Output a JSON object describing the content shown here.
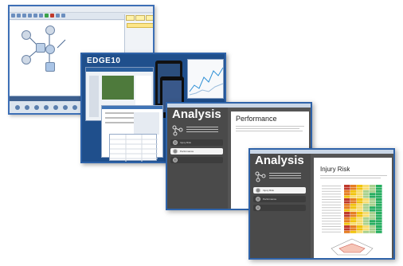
{
  "workflow_window": {
    "nodes": [
      {
        "id": "n1"
      },
      {
        "id": "n2"
      },
      {
        "id": "n3"
      },
      {
        "id": "n4"
      },
      {
        "id": "n5"
      },
      {
        "id": "n6"
      }
    ]
  },
  "edge10_window": {
    "logo": "EDGE10"
  },
  "analysis_performance": {
    "heading": "Analysis",
    "pane_title": "Performance",
    "menu": [
      {
        "label": "Injury Risk",
        "active": false
      },
      {
        "label": "Performance",
        "active": true
      },
      {
        "label": "",
        "active": false
      }
    ]
  },
  "analysis_injury": {
    "heading": "Analysis",
    "pane_title": "Injury Risk",
    "menu": [
      {
        "label": "Injury Risk",
        "active": true
      },
      {
        "label": "Performance",
        "active": false
      },
      {
        "label": "",
        "active": false
      }
    ]
  },
  "colors": {
    "window_border": "#2f63a9",
    "analysis_bg": "#555555",
    "edge10_bg": "#1f4f8c",
    "heatmap_high": "#c0392b",
    "heatmap_mid": "#f1c40f",
    "heatmap_low": "#27ae60"
  }
}
